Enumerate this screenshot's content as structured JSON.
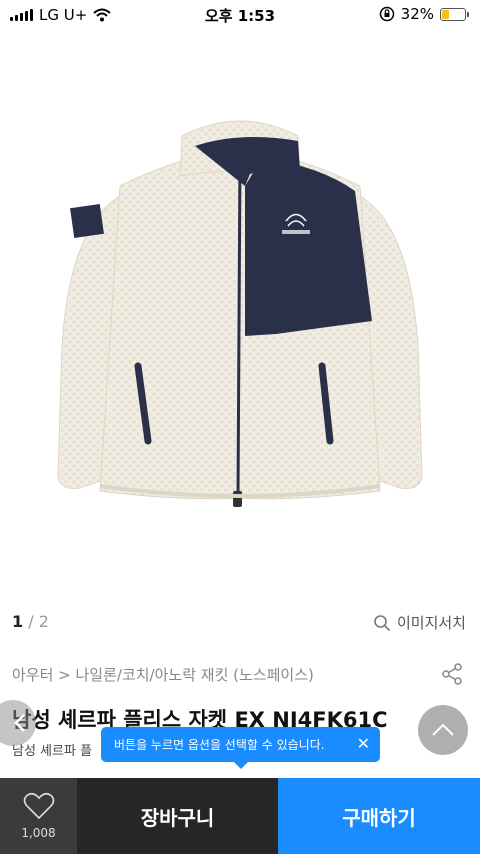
{
  "status": {
    "carrier": "LG U+",
    "time": "오후 1:53",
    "battery": "32%",
    "battery_level": 0.32
  },
  "pager": {
    "current": "1",
    "separator": " / ",
    "total": "2"
  },
  "image_search_label": "이미지서치",
  "breadcrumb": "아우터 > 나일론/코치/아노락 재킷 (노스페이스)",
  "product": {
    "title": "남성 셰르파 플리스 자켓 EX NJ4FK61C",
    "subtitle": "남성 셰르파 플"
  },
  "tooltip": {
    "text": "버튼을 누르면 옵션을 선택할 수 있습니다.",
    "close": "✕"
  },
  "bottom_bar": {
    "like_count": "1,008",
    "cart_label": "장바구니",
    "buy_label": "구매하기"
  },
  "colors": {
    "accent": "#1a8cff",
    "cart_bg": "#262626",
    "like_bg": "#3b3b3b",
    "jacket_body": "#f1ede3",
    "jacket_panel": "#2a2f4a"
  }
}
